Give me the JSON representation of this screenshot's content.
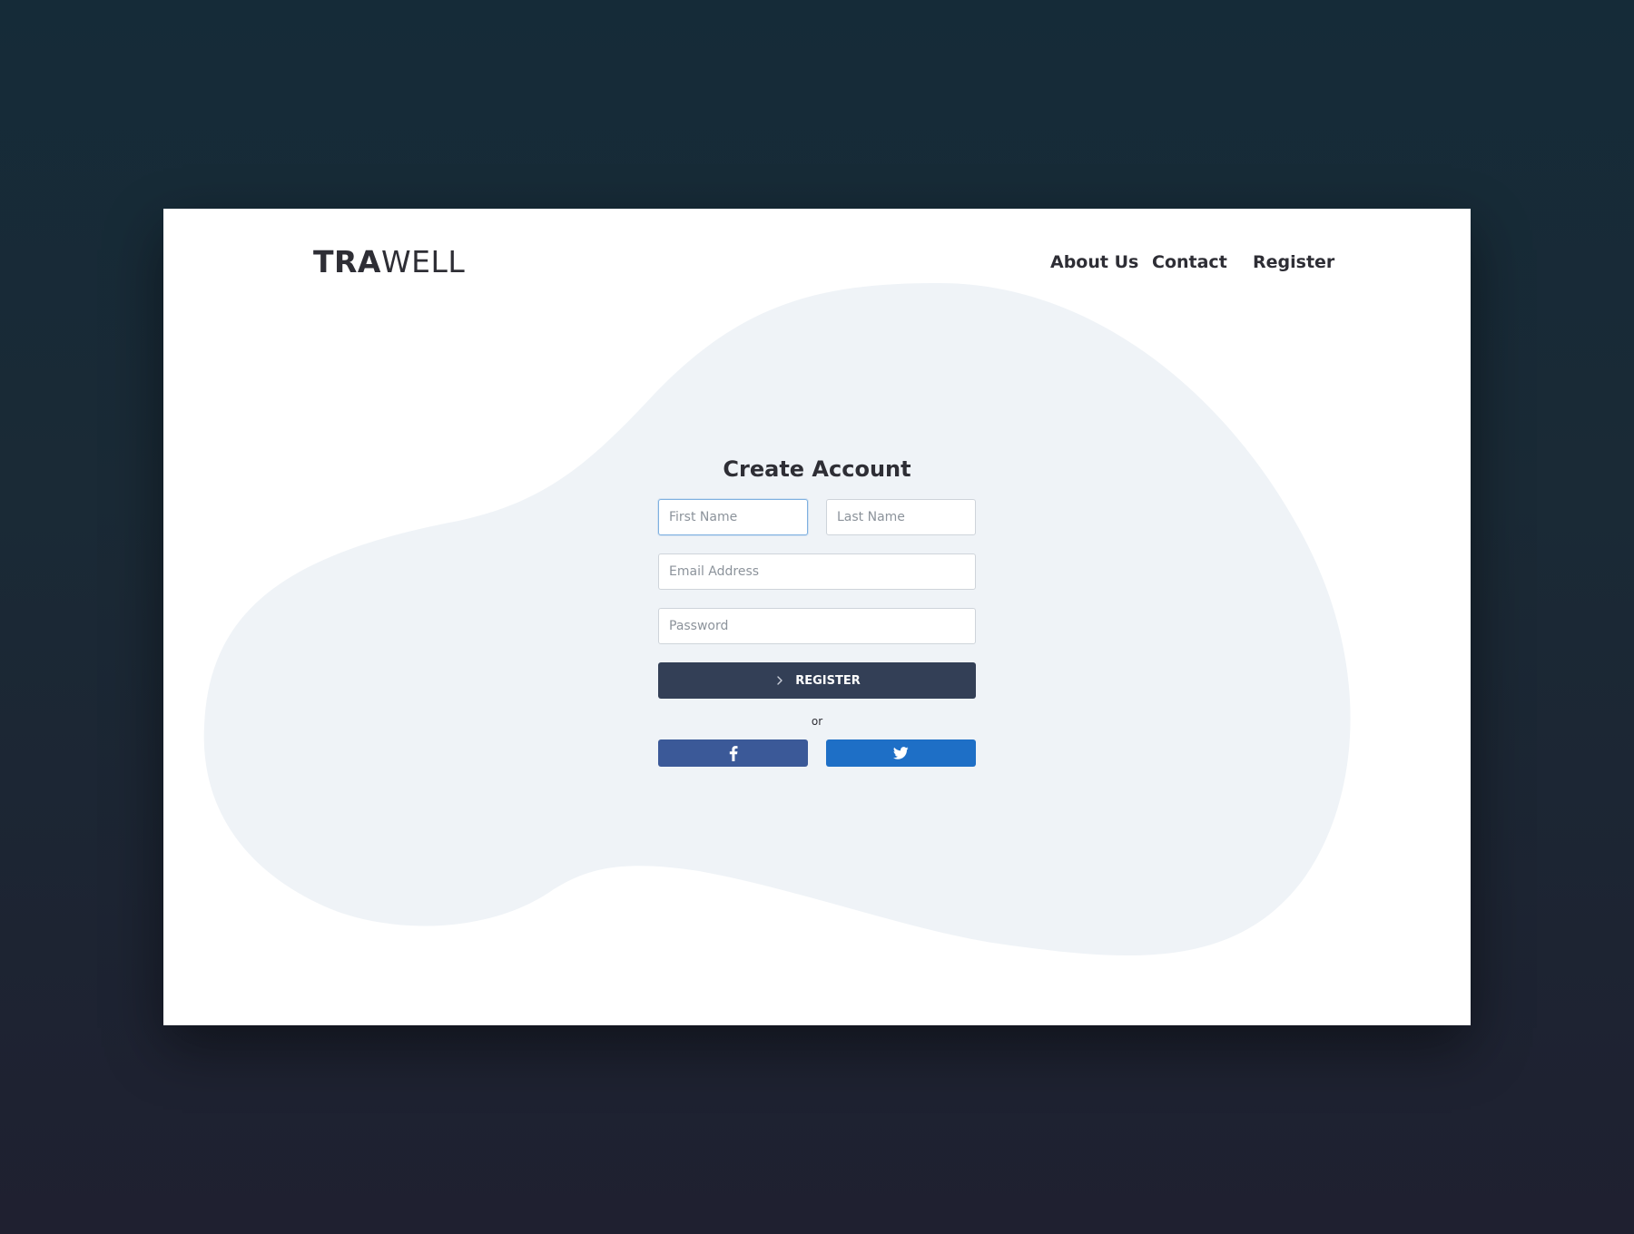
{
  "brand": {
    "logo_bold": "TRA",
    "logo_light": "WELL"
  },
  "nav": {
    "items": [
      {
        "label": "About Us"
      },
      {
        "label": "Contact"
      },
      {
        "label": "Register"
      }
    ]
  },
  "form": {
    "title": "Create Account",
    "first_name": {
      "placeholder": "First Name",
      "value": ""
    },
    "last_name": {
      "placeholder": "Last Name",
      "value": ""
    },
    "email": {
      "placeholder": "Email Address",
      "value": ""
    },
    "password": {
      "placeholder": "Password",
      "value": ""
    },
    "submit_label": "REGISTER",
    "submit_icon": "chevron-right-icon",
    "divider_text": "or",
    "social": [
      {
        "name": "facebook",
        "icon": "facebook-icon",
        "color": "#3b5998"
      },
      {
        "name": "twitter",
        "icon": "twitter-icon",
        "color": "#1e6fc6"
      }
    ]
  },
  "colors": {
    "page_background_top": "#152b38",
    "page_background_bottom": "#1f2030",
    "card": "#ffffff",
    "blob": "#eff3f7",
    "text": "#2e2e35",
    "primary_button": "#333f56",
    "focus_border": "#7fb0e0"
  }
}
